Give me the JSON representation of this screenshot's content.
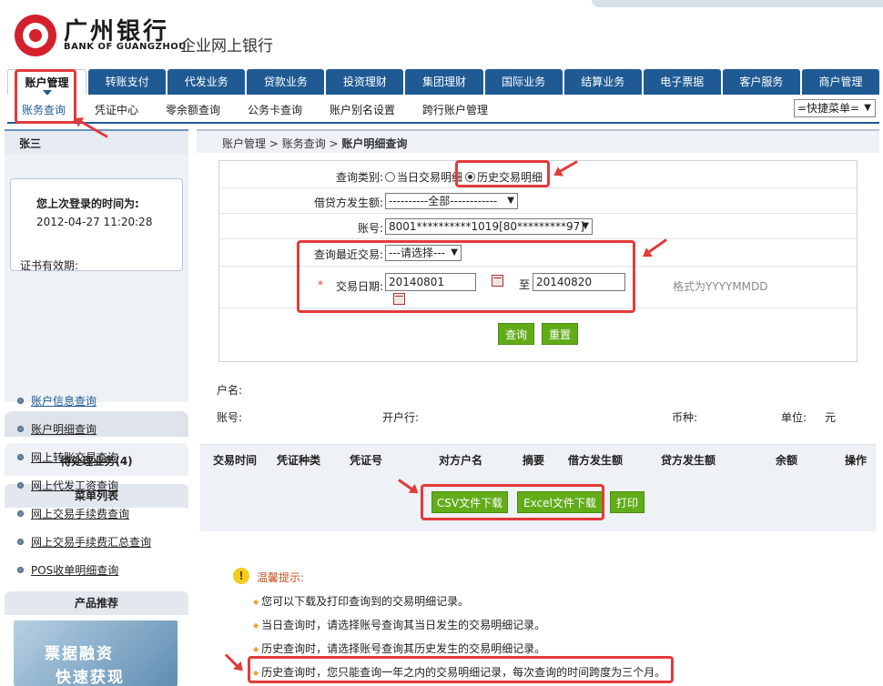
{
  "header": {
    "bank_name_cn": "广州银行",
    "bank_name_en": "BANK OF GUANGZHOU",
    "subtitle": "企业网上银行"
  },
  "main_nav": [
    "账户管理",
    "转账支付",
    "代发业务",
    "贷款业务",
    "投资理财",
    "集团理财",
    "国际业务",
    "结算业务",
    "电子票据",
    "客户服务",
    "商户管理"
  ],
  "sub_nav": [
    "账务查询",
    "凭证中心",
    "零余额查询",
    "公务卡查询",
    "账户别名设置",
    "跨行账户管理"
  ],
  "quick_menu": "=快捷菜单=",
  "sidebar": {
    "user_name": "张三",
    "last_login_label": "您上次登录的时间为:",
    "last_login_time": "2012-04-27 11:20:28",
    "cert_validity_label": "证书有效期:",
    "pending_label": "待处理业务(4)",
    "menu_title": "菜单列表",
    "menu_items": [
      "账户信息查询",
      "账户明细查询",
      "网上转账交易查询",
      "网上代发工资查询",
      "网上交易手续费查询",
      "网上交易手续费汇总查询",
      "POS收单明细查询"
    ],
    "product_title": "产品推荐",
    "promo_line1": "票据融资",
    "promo_line2": "快速获现"
  },
  "breadcrumb": {
    "level1": "账户管理",
    "level2": "账务查询",
    "current": "账户明细查询"
  },
  "query_form": {
    "type_label": "查询类别:",
    "type_option_today": "当日交易明细",
    "type_option_history": "历史交易明细",
    "selected_type": "历史交易明细",
    "amount_label": "借贷方发生额:",
    "amount_value": "----------全部------------",
    "account_label": "账号:",
    "account_value": "8001**********1019[80*********97]",
    "recent_label": "查询最近交易:",
    "recent_value": "---请选择---",
    "required_mark": "*",
    "date_label": "交易日期:",
    "date_from": "20140801",
    "date_to_separator": "至",
    "date_to": "20140820",
    "date_format_hint": "格式为YYYYMMDD",
    "query_button": "查询",
    "reset_button": "重置"
  },
  "account_info": {
    "name_label": "户名:",
    "account_label": "账号:",
    "bank_label": "开户行:",
    "currency_label": "币种:",
    "unit_label": "单位:",
    "unit_value": "元"
  },
  "table": {
    "columns": [
      "交易时间",
      "凭证种类",
      "凭证号",
      "对方户名",
      "摘要",
      "借方发生额",
      "贷方发生额",
      "余额",
      "操作"
    ],
    "rows": []
  },
  "actions": {
    "csv_button": "CSV文件下载",
    "excel_button": "Excel文件下载",
    "print_button": "打印"
  },
  "tips": {
    "title": "温馨提示:",
    "items": [
      "您可以下载及打印查询到的交易明细记录。",
      "当日查询时，请选择账号查询其当日发生的交易明细记录。",
      "历史查询时，请选择账号查询其历史发生的交易明细记录。",
      "历史查询时，您只能查询一年之内的交易明细记录，每次查询的时间跨度为三个月。"
    ]
  },
  "colors": {
    "nav_blue": "#1f5a94",
    "button_green": "#62ac1a",
    "highlight_red": "#e33a3a"
  }
}
